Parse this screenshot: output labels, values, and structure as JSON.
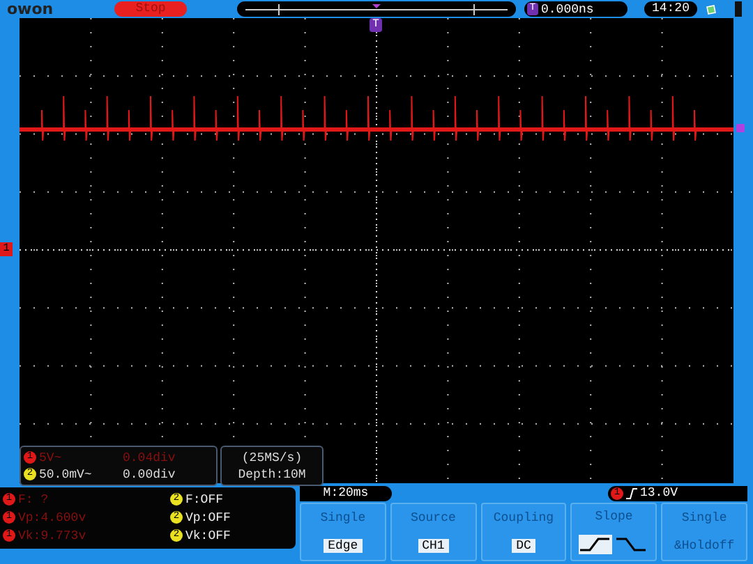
{
  "header": {
    "brand": "owon",
    "run_state": "Stop",
    "trigger_badge": "T",
    "trigger_position": "0.000ns",
    "time": "14:20"
  },
  "graticule": {
    "trigger_marker": "T",
    "channel_marker": {
      "label": "1",
      "color": "#e01818"
    }
  },
  "channel_readouts": [
    {
      "channel": "1",
      "color": "#e01818",
      "scale": "5V~",
      "position": "0.04div"
    },
    {
      "channel": "2",
      "color": "#e8e020",
      "scale": "50.0mV~",
      "position": "0.00div"
    }
  ],
  "acquisition": {
    "sample_rate": "(25MS/s)",
    "depth": "Depth:10M"
  },
  "measurements": [
    {
      "channel": "1",
      "color": "#e01818",
      "text": "F:  ?"
    },
    {
      "channel": "2",
      "color": "#e8e020",
      "text": "F:OFF"
    },
    {
      "channel": "1",
      "color": "#e01818",
      "text": "Vp:4.600v"
    },
    {
      "channel": "2",
      "color": "#e8e020",
      "text": "Vp:OFF"
    },
    {
      "channel": "1",
      "color": "#e01818",
      "text": "Vk:9.773v"
    },
    {
      "channel": "2",
      "color": "#e8e020",
      "text": "Vk:OFF"
    }
  ],
  "timebase": "M:20ms",
  "trigger": {
    "channel": "1",
    "color": "#e01818",
    "level": "13.0V"
  },
  "menu": [
    {
      "kind": "value",
      "title": "Single",
      "value": "Edge"
    },
    {
      "kind": "value",
      "title": "Source",
      "value": "CH1"
    },
    {
      "kind": "value",
      "title": "Coupling",
      "value": "DC"
    },
    {
      "kind": "slope",
      "title": "Slope",
      "options": [
        {
          "kind": "rising",
          "selected": true
        },
        {
          "kind": "falling",
          "selected": false
        }
      ]
    },
    {
      "kind": "text",
      "title": "Single",
      "value": "&Holdoff"
    }
  ]
}
